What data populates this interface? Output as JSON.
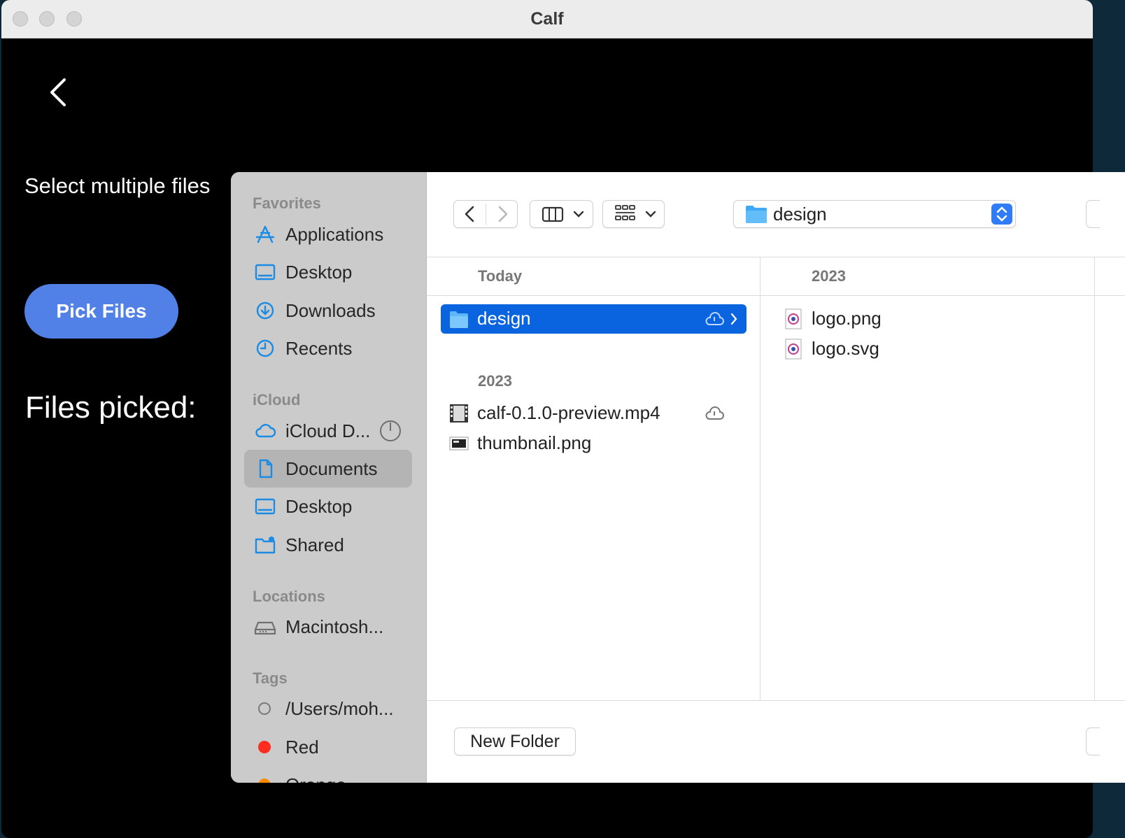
{
  "window": {
    "title": "Calf"
  },
  "app": {
    "label": "Select multiple files",
    "pick_button": "Pick Files",
    "files_picked": "Files picked:"
  },
  "dialog": {
    "sidebar": {
      "favorites_header": "Favorites",
      "favorites": [
        {
          "label": "Applications",
          "icon": "applications-icon"
        },
        {
          "label": "Desktop",
          "icon": "desktop-icon"
        },
        {
          "label": "Downloads",
          "icon": "downloads-icon"
        },
        {
          "label": "Recents",
          "icon": "recents-icon"
        }
      ],
      "icloud_header": "iCloud",
      "icloud": [
        {
          "label": "iCloud D...",
          "icon": "cloud-icon"
        },
        {
          "label": "Documents",
          "icon": "document-icon",
          "selected": true
        },
        {
          "label": "Desktop",
          "icon": "desktop-icon"
        },
        {
          "label": "Shared",
          "icon": "shared-folder-icon"
        }
      ],
      "locations_header": "Locations",
      "locations": [
        {
          "label": "Macintosh...",
          "icon": "drive-icon"
        }
      ],
      "tags_header": "Tags",
      "tags": [
        {
          "label": "/Users/moh...",
          "color": "none"
        },
        {
          "label": "Red",
          "color": "#ff2d20"
        },
        {
          "label": "Orange",
          "color": "#ff8a00"
        }
      ]
    },
    "path_popup": {
      "label": "design"
    },
    "columns": [
      {
        "groups": [
          {
            "header": "Today",
            "items": [
              {
                "name": "design",
                "type": "folder",
                "selected": true
              }
            ]
          },
          {
            "header": "2023",
            "items": [
              {
                "name": "calf-0.1.0-preview.mp4",
                "type": "video"
              },
              {
                "name": "thumbnail.png",
                "type": "image"
              }
            ]
          }
        ]
      },
      {
        "groups": [
          {
            "header": "2023",
            "items": [
              {
                "name": "logo.png",
                "type": "image"
              },
              {
                "name": "logo.svg",
                "type": "image"
              }
            ]
          }
        ]
      }
    ],
    "new_folder_button": "New Folder"
  },
  "colors": {
    "accent": "#0a64e0",
    "pick_button": "#5181e6",
    "sidebar_bg": "#cbcbcb",
    "icon_blue": "#1a8ce6"
  }
}
